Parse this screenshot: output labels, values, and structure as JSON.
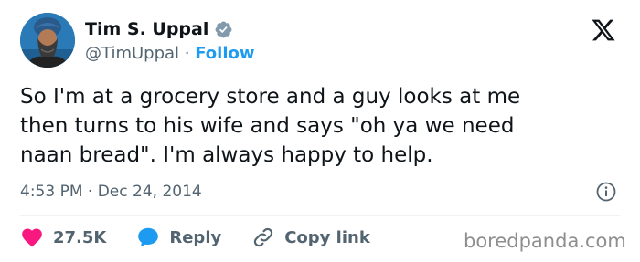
{
  "author": {
    "name": "Tim S. Uppal",
    "handle": "@TimUppal",
    "separator": " · ",
    "follow_label": "Follow"
  },
  "tweet": {
    "text": "So I'm at a grocery store and a guy looks at me\nthen turns to his wife and says \"oh ya we need\nnaan bread\". I'm always happy to help.",
    "time": "4:53 PM",
    "date_separator": " · ",
    "date": "Dec 24, 2014"
  },
  "actions": {
    "likes_count": "27.5K",
    "reply_label": "Reply",
    "copy_link_label": "Copy link"
  },
  "watermark": "boredpanda.com",
  "colors": {
    "accent": "#1d9bf0",
    "like": "#f91880",
    "text": "#0f1419",
    "muted": "#536471"
  },
  "icons": {
    "verified": "verified-badge-icon",
    "platform": "x-logo-icon",
    "info": "info-icon",
    "like": "heart-icon",
    "reply": "speech-bubble-icon",
    "copy_link": "link-icon"
  }
}
